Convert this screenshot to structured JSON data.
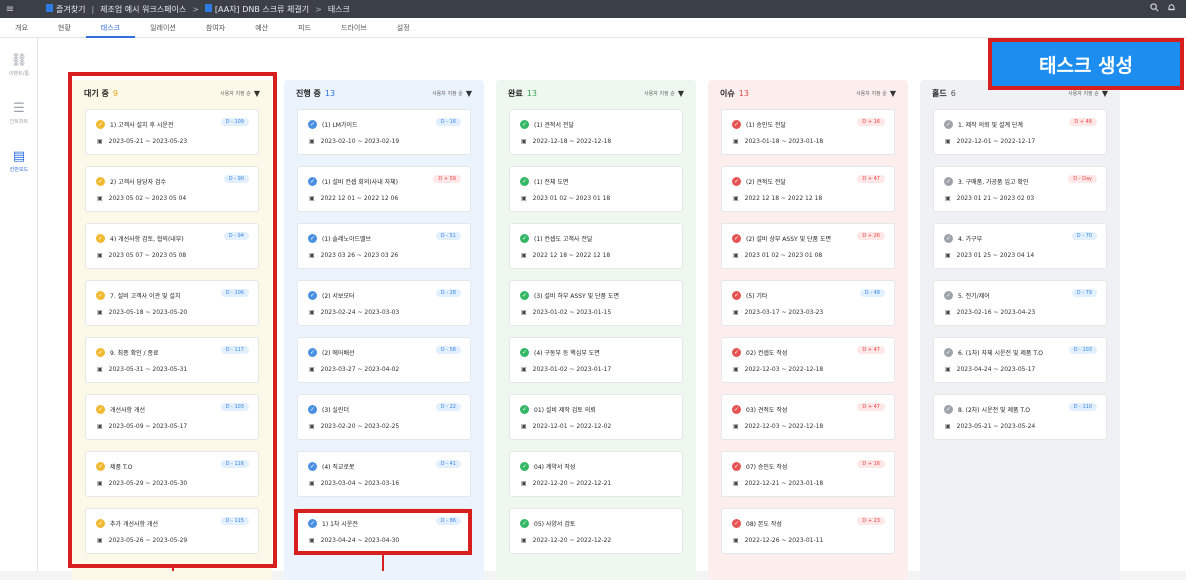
{
  "topbar": {
    "menu_icon": "≡",
    "breadcrumb": [
      {
        "label": "즐겨찾기",
        "flag": true
      },
      {
        "label": "제조업 예시 워크스페이스",
        "flag": false
      },
      {
        "label": "[AA자] DNB 스크류 체결기",
        "flag": true
      },
      {
        "label": "태스크",
        "flag": false
      }
    ],
    "search_icon": "search-icon",
    "bell_icon": "bell-icon"
  },
  "tabs": [
    {
      "label": "개요",
      "active": false
    },
    {
      "label": "현황",
      "active": false
    },
    {
      "label": "태스크",
      "active": true
    },
    {
      "label": "일레이션",
      "active": false
    },
    {
      "label": "참여자",
      "active": false
    },
    {
      "label": "예산",
      "active": false
    },
    {
      "label": "피드",
      "active": false
    },
    {
      "label": "드라이브",
      "active": false
    },
    {
      "label": "설정",
      "active": false
    }
  ],
  "sidenav": [
    {
      "label": "이벤트/통",
      "icon": "network-icon",
      "active": false
    },
    {
      "label": "간트차트",
      "icon": "gantt-icon",
      "active": false
    },
    {
      "label": "칸반보드",
      "icon": "kanban-icon",
      "active": true
    }
  ],
  "create_button": "태스크 생성",
  "sort_label": "사용자 지정 순",
  "columns": [
    {
      "title": "대기 중",
      "count": "9",
      "bg": "#fdf9e8",
      "count_color": "#e8a317",
      "check_color": "#f1b92f",
      "cards": [
        {
          "title": "1) 고객사 설치 후 시운전",
          "badge": "D - 109",
          "badge_type": "blue",
          "dates": "2023-05-21 ~ 2023-05-23"
        },
        {
          "title": "2) 고객사 담당자 검수",
          "badge": "D - 90",
          "badge_type": "blue",
          "dates": "2023 05 02 ~ 2023 05 04"
        },
        {
          "title": "4) 개선사항 검토, 협의(내부)",
          "badge": "D - 94",
          "badge_type": "blue",
          "dates": "2023 05 07 ~ 2023 05 08"
        },
        {
          "title": "7. 설비 고객사 이관 및 설치",
          "badge": "D - 106",
          "badge_type": "blue",
          "dates": "2023-05-18 ~ 2023-05-20"
        },
        {
          "title": "9. 최종 확인 / 종료",
          "badge": "D - 117",
          "badge_type": "blue",
          "dates": "2023-05-31 ~ 2023-05-31"
        },
        {
          "title": "개선사항 개선",
          "badge": "D - 103",
          "badge_type": "blue",
          "dates": "2023-05-09 ~ 2023-05-17"
        },
        {
          "title": "제품 T.O",
          "badge": "D - 116",
          "badge_type": "blue",
          "dates": "2023-05-29 ~ 2023-05-30"
        },
        {
          "title": "추가 개선사항 개선",
          "badge": "D - 115",
          "badge_type": "blue",
          "dates": "2023-05-26 ~ 2023-05-29"
        }
      ]
    },
    {
      "title": "진행 중",
      "count": "13",
      "bg": "#ebf3fd",
      "count_color": "#2f6fdf",
      "check_color": "#4a90e2",
      "cards": [
        {
          "title": "(1) LM가이드",
          "badge": "D - 16",
          "badge_type": "blue",
          "dates": "2023-02-10 ~ 2023-02-19"
        },
        {
          "title": "(1) 설비 컨셉 회의(사내 자체)",
          "badge": "D + 59",
          "badge_type": "red",
          "dates": "2022 12 01 ~ 2022 12 06"
        },
        {
          "title": "(1) 솔레노이드밸브",
          "badge": "D - 51",
          "badge_type": "blue",
          "dates": "2023 03 26 ~ 2023 03 26"
        },
        {
          "title": "(2) 서보모터",
          "badge": "D - 28",
          "badge_type": "blue",
          "dates": "2023-02-24 ~ 2023-03-03"
        },
        {
          "title": "(2) 에어배선",
          "badge": "D - 58",
          "badge_type": "blue",
          "dates": "2023-03-27 ~ 2023-04-02"
        },
        {
          "title": "(3) 실린더",
          "badge": "D - 22",
          "badge_type": "blue",
          "dates": "2023-02-20 ~ 2023-02-25"
        },
        {
          "title": "(4) 직교로봇",
          "badge": "D - 41",
          "badge_type": "blue",
          "dates": "2023-03-04 ~ 2023-03-16"
        },
        {
          "title": "1) 1차 시운전",
          "badge": "D - 86",
          "badge_type": "blue",
          "dates": "2023-04-24 ~ 2023-04-30"
        }
      ]
    },
    {
      "title": "완료",
      "count": "13",
      "bg": "#eef8ef",
      "count_color": "#2fa84f",
      "check_color": "#34b765",
      "cards": [
        {
          "title": "(1) 견적서 전달",
          "badge": "",
          "badge_type": "",
          "dates": "2022-12-18 ~ 2022-12-18"
        },
        {
          "title": "(1) 전체 도면",
          "badge": "",
          "badge_type": "",
          "dates": "2023 01 02 ~ 2023 01 18"
        },
        {
          "title": "(1) 컨셉도 고객사 전달",
          "badge": "",
          "badge_type": "",
          "dates": "2022 12 18 ~ 2022 12 18"
        },
        {
          "title": "(3) 설비 하부 ASSY 및 단품 도면",
          "badge": "",
          "badge_type": "",
          "dates": "2023-01-02 ~ 2023-01-15"
        },
        {
          "title": "(4) 구동부 등 핵심부 도면",
          "badge": "",
          "badge_type": "",
          "dates": "2023-01-02 ~ 2023-01-17"
        },
        {
          "title": "01) 설비 제작 검토 의뢰",
          "badge": "",
          "badge_type": "",
          "dates": "2022-12-01 ~ 2022-12-02"
        },
        {
          "title": "04) 계약서 작성",
          "badge": "",
          "badge_type": "",
          "dates": "2022-12-20 ~ 2022-12-21"
        },
        {
          "title": "05) 사양서 검토",
          "badge": "",
          "badge_type": "",
          "dates": "2022-12-20 ~ 2022-12-22"
        }
      ]
    },
    {
      "title": "이슈",
      "count": "13",
      "bg": "#fdeeee",
      "count_color": "#e04848",
      "check_color": "#e55353",
      "cards": [
        {
          "title": "(1) 승인도 전달",
          "badge": "D + 16",
          "badge_type": "red",
          "dates": "2023-01-18 ~ 2023-01-18"
        },
        {
          "title": "(2) 견적도 전달",
          "badge": "D + 47",
          "badge_type": "red",
          "dates": "2022 12 18 ~ 2022 12 18"
        },
        {
          "title": "(2) 설비 상부 ASSY 및 단품 도면",
          "badge": "D + 26",
          "badge_type": "red",
          "dates": "2023 01 02 ~ 2023 01 08"
        },
        {
          "title": "(5) 기타",
          "badge": "D - 48",
          "badge_type": "blue",
          "dates": "2023-03-17 ~ 2023-03-23"
        },
        {
          "title": "02) 컨셉도 작성",
          "badge": "D + 47",
          "badge_type": "red",
          "dates": "2022-12-03 ~ 2022-12-18"
        },
        {
          "title": "03) 견적도 작성",
          "badge": "D + 47",
          "badge_type": "red",
          "dates": "2022-12-03 ~ 2022-12-18"
        },
        {
          "title": "07) 승인도 작성",
          "badge": "D + 16",
          "badge_type": "red",
          "dates": "2022-12-21 ~ 2023-01-18"
        },
        {
          "title": "08) 본도 작성",
          "badge": "D + 23",
          "badge_type": "red",
          "dates": "2022-12-26 ~ 2023-01-11"
        }
      ]
    },
    {
      "title": "홀드",
      "count": "6",
      "bg": "#f0f1f4",
      "count_color": "#555555",
      "check_color": "#9ea3aa",
      "cards": [
        {
          "title": "1. 제작 의뢰 및 설계 단계",
          "badge": "D + 48",
          "badge_type": "red",
          "dates": "2022-12-01 ~ 2022-12-17"
        },
        {
          "title": "3. 구매품, 가공품 입고 확인",
          "badge": "D - Day",
          "badge_type": "red",
          "dates": "2023 01 21 ~ 2023 02 03"
        },
        {
          "title": "4. 가구부",
          "badge": "D - 70",
          "badge_type": "blue",
          "dates": "2023 01 25 ~ 2023 04 14"
        },
        {
          "title": "5. 전기/제어",
          "badge": "D - 79",
          "badge_type": "blue",
          "dates": "2023-02-16 ~ 2023-04-23"
        },
        {
          "title": "6. (1차) 자체 시운전 및 제품 T.O",
          "badge": "D - 103",
          "badge_type": "blue",
          "dates": "2023-04-24 ~ 2023-05-17"
        },
        {
          "title": "8. (2차) 시운전 및 제품 T.O",
          "badge": "D - 110",
          "badge_type": "blue",
          "dates": "2023-05-21 ~ 2023-05-24"
        }
      ]
    }
  ]
}
